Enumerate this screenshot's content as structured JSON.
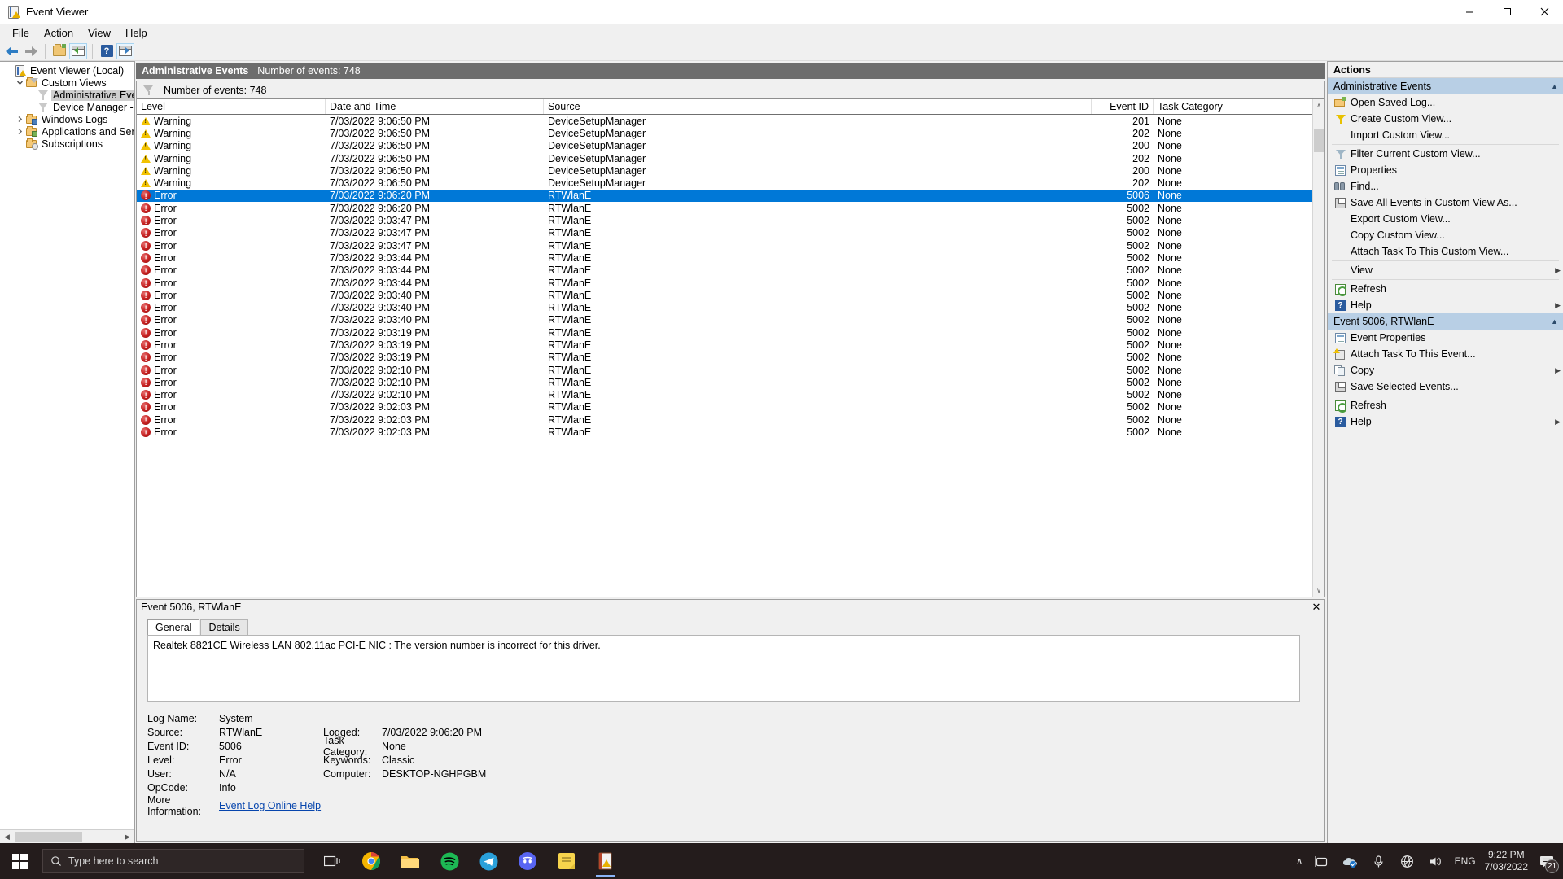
{
  "window": {
    "title": "Event Viewer",
    "icon": "event-viewer-icon",
    "minimize": "—",
    "maximize": "❐",
    "close": "✕"
  },
  "menu": {
    "items": [
      "File",
      "Action",
      "View",
      "Help"
    ]
  },
  "toolbar": {
    "back": "back-arrow",
    "forward": "forward-arrow",
    "open": "open-folder",
    "show_pane": "show-console-tree",
    "help": "?",
    "properties_pane": "show-action-pane"
  },
  "tree": {
    "nodes": [
      {
        "label": "Event Viewer (Local)",
        "icon": "event-viewer-icon",
        "indent": 0,
        "chevron": "none",
        "selected": false
      },
      {
        "label": "Custom Views",
        "icon": "folder-funnel-icon",
        "indent": 1,
        "chevron": "down",
        "selected": false
      },
      {
        "label": "Administrative Events",
        "icon": "filter-icon",
        "indent": 2,
        "chevron": "none",
        "selected": true
      },
      {
        "label": "Device Manager - Realtek",
        "icon": "filter-icon",
        "indent": 2,
        "chevron": "none",
        "selected": false
      },
      {
        "label": "Windows Logs",
        "icon": "folder-window-icon",
        "indent": 1,
        "chevron": "right",
        "selected": false
      },
      {
        "label": "Applications and Services Lo",
        "icon": "folder-app-icon",
        "indent": 1,
        "chevron": "right",
        "selected": false
      },
      {
        "label": "Subscriptions",
        "icon": "folder-sub-icon",
        "indent": 1,
        "chevron": "none",
        "selected": false
      }
    ],
    "hscroll_left": "◀",
    "hscroll_right": "▶"
  },
  "center": {
    "header_title": "Administrative Events",
    "header_count": "Number of events: 748",
    "filter_text": "Number of events: 748",
    "columns": [
      "Level",
      "Date and Time",
      "Source",
      "Event ID",
      "Task Category"
    ],
    "scroll_up": "∧",
    "scroll_down": "∨",
    "rows": [
      {
        "level": "Warning",
        "date": "7/03/2022 9:06:50 PM",
        "source": "DeviceSetupManager",
        "event_id": "201",
        "task": "None",
        "selected": false
      },
      {
        "level": "Warning",
        "date": "7/03/2022 9:06:50 PM",
        "source": "DeviceSetupManager",
        "event_id": "202",
        "task": "None",
        "selected": false
      },
      {
        "level": "Warning",
        "date": "7/03/2022 9:06:50 PM",
        "source": "DeviceSetupManager",
        "event_id": "200",
        "task": "None",
        "selected": false
      },
      {
        "level": "Warning",
        "date": "7/03/2022 9:06:50 PM",
        "source": "DeviceSetupManager",
        "event_id": "202",
        "task": "None",
        "selected": false
      },
      {
        "level": "Warning",
        "date": "7/03/2022 9:06:50 PM",
        "source": "DeviceSetupManager",
        "event_id": "200",
        "task": "None",
        "selected": false
      },
      {
        "level": "Warning",
        "date": "7/03/2022 9:06:50 PM",
        "source": "DeviceSetupManager",
        "event_id": "202",
        "task": "None",
        "selected": false
      },
      {
        "level": "Error",
        "date": "7/03/2022 9:06:20 PM",
        "source": "RTWlanE",
        "event_id": "5006",
        "task": "None",
        "selected": true
      },
      {
        "level": "Error",
        "date": "7/03/2022 9:06:20 PM",
        "source": "RTWlanE",
        "event_id": "5002",
        "task": "None",
        "selected": false
      },
      {
        "level": "Error",
        "date": "7/03/2022 9:03:47 PM",
        "source": "RTWlanE",
        "event_id": "5002",
        "task": "None",
        "selected": false
      },
      {
        "level": "Error",
        "date": "7/03/2022 9:03:47 PM",
        "source": "RTWlanE",
        "event_id": "5002",
        "task": "None",
        "selected": false
      },
      {
        "level": "Error",
        "date": "7/03/2022 9:03:47 PM",
        "source": "RTWlanE",
        "event_id": "5002",
        "task": "None",
        "selected": false
      },
      {
        "level": "Error",
        "date": "7/03/2022 9:03:44 PM",
        "source": "RTWlanE",
        "event_id": "5002",
        "task": "None",
        "selected": false
      },
      {
        "level": "Error",
        "date": "7/03/2022 9:03:44 PM",
        "source": "RTWlanE",
        "event_id": "5002",
        "task": "None",
        "selected": false
      },
      {
        "level": "Error",
        "date": "7/03/2022 9:03:44 PM",
        "source": "RTWlanE",
        "event_id": "5002",
        "task": "None",
        "selected": false
      },
      {
        "level": "Error",
        "date": "7/03/2022 9:03:40 PM",
        "source": "RTWlanE",
        "event_id": "5002",
        "task": "None",
        "selected": false
      },
      {
        "level": "Error",
        "date": "7/03/2022 9:03:40 PM",
        "source": "RTWlanE",
        "event_id": "5002",
        "task": "None",
        "selected": false
      },
      {
        "level": "Error",
        "date": "7/03/2022 9:03:40 PM",
        "source": "RTWlanE",
        "event_id": "5002",
        "task": "None",
        "selected": false
      },
      {
        "level": "Error",
        "date": "7/03/2022 9:03:19 PM",
        "source": "RTWlanE",
        "event_id": "5002",
        "task": "None",
        "selected": false
      },
      {
        "level": "Error",
        "date": "7/03/2022 9:03:19 PM",
        "source": "RTWlanE",
        "event_id": "5002",
        "task": "None",
        "selected": false
      },
      {
        "level": "Error",
        "date": "7/03/2022 9:03:19 PM",
        "source": "RTWlanE",
        "event_id": "5002",
        "task": "None",
        "selected": false
      },
      {
        "level": "Error",
        "date": "7/03/2022 9:02:10 PM",
        "source": "RTWlanE",
        "event_id": "5002",
        "task": "None",
        "selected": false
      },
      {
        "level": "Error",
        "date": "7/03/2022 9:02:10 PM",
        "source": "RTWlanE",
        "event_id": "5002",
        "task": "None",
        "selected": false
      },
      {
        "level": "Error",
        "date": "7/03/2022 9:02:10 PM",
        "source": "RTWlanE",
        "event_id": "5002",
        "task": "None",
        "selected": false
      },
      {
        "level": "Error",
        "date": "7/03/2022 9:02:03 PM",
        "source": "RTWlanE",
        "event_id": "5002",
        "task": "None",
        "selected": false
      },
      {
        "level": "Error",
        "date": "7/03/2022 9:02:03 PM",
        "source": "RTWlanE",
        "event_id": "5002",
        "task": "None",
        "selected": false
      },
      {
        "level": "Error",
        "date": "7/03/2022 9:02:03 PM",
        "source": "RTWlanE",
        "event_id": "5002",
        "task": "None",
        "selected": false
      }
    ]
  },
  "detail": {
    "title": "Event 5006, RTWlanE",
    "close": "✕",
    "tabs": [
      {
        "label": "General",
        "active": true
      },
      {
        "label": "Details",
        "active": false
      }
    ],
    "message": "Realtek 8821CE Wireless LAN 802.11ac PCI-E NIC : The version number is incorrect for this driver.",
    "fields": [
      {
        "k1": "Log Name:",
        "v1": "System",
        "k2": "",
        "v2": ""
      },
      {
        "k1": "Source:",
        "v1": "RTWlanE",
        "k2": "Logged:",
        "v2": "7/03/2022 9:06:20 PM"
      },
      {
        "k1": "Event ID:",
        "v1": "5006",
        "k2": "Task Category:",
        "v2": "None"
      },
      {
        "k1": "Level:",
        "v1": "Error",
        "k2": "Keywords:",
        "v2": "Classic"
      },
      {
        "k1": "User:",
        "v1": "N/A",
        "k2": "Computer:",
        "v2": "DESKTOP-NGHPGBM"
      },
      {
        "k1": "OpCode:",
        "v1": "Info",
        "k2": "",
        "v2": ""
      }
    ],
    "more_info_label": "More Information:",
    "more_info_link": "Event Log Online Help"
  },
  "actions": {
    "title": "Actions",
    "groups": [
      {
        "name": "Administrative Events",
        "caret": "▲",
        "items": [
          {
            "label": "Open Saved Log...",
            "icon": "open-saved-log-icon",
            "submenu": false
          },
          {
            "label": "Create Custom View...",
            "icon": "create-custom-view-icon",
            "submenu": false
          },
          {
            "label": "Import Custom View...",
            "icon": "none",
            "submenu": false
          },
          {
            "label": "Filter Current Custom View...",
            "icon": "filter-icon",
            "submenu": false,
            "sep_before": true
          },
          {
            "label": "Properties",
            "icon": "properties-icon",
            "submenu": false
          },
          {
            "label": "Find...",
            "icon": "find-icon",
            "submenu": false
          },
          {
            "label": "Save All Events in Custom View As...",
            "icon": "save-icon",
            "submenu": false
          },
          {
            "label": "Export Custom View...",
            "icon": "none",
            "submenu": false
          },
          {
            "label": "Copy Custom View...",
            "icon": "none",
            "submenu": false
          },
          {
            "label": "Attach Task To This Custom View...",
            "icon": "none",
            "submenu": false
          },
          {
            "label": "View",
            "icon": "none",
            "submenu": true,
            "sep_before": true
          },
          {
            "label": "Refresh",
            "icon": "refresh-icon",
            "submenu": false,
            "sep_before": true
          },
          {
            "label": "Help",
            "icon": "help-icon",
            "submenu": true
          }
        ]
      },
      {
        "name": "Event 5006, RTWlanE",
        "caret": "▲",
        "items": [
          {
            "label": "Event Properties",
            "icon": "properties-icon",
            "submenu": false
          },
          {
            "label": "Attach Task To This Event...",
            "icon": "attach-task-icon",
            "submenu": false
          },
          {
            "label": "Copy",
            "icon": "copy-icon",
            "submenu": true
          },
          {
            "label": "Save Selected Events...",
            "icon": "save-icon",
            "submenu": false
          },
          {
            "label": "Refresh",
            "icon": "refresh-icon",
            "submenu": false,
            "sep_before": true
          },
          {
            "label": "Help",
            "icon": "help-icon",
            "submenu": true
          }
        ]
      }
    ]
  },
  "taskbar": {
    "search_placeholder": "Type here to search",
    "apps": [
      "task-view",
      "chrome",
      "file-explorer",
      "spotify",
      "telegram",
      "discord",
      "sticky-notes",
      "event-viewer"
    ],
    "tray": {
      "expand": "∧",
      "language": "ENG",
      "time": "9:22 PM",
      "date": "7/03/2022",
      "notification_count": "21"
    }
  }
}
